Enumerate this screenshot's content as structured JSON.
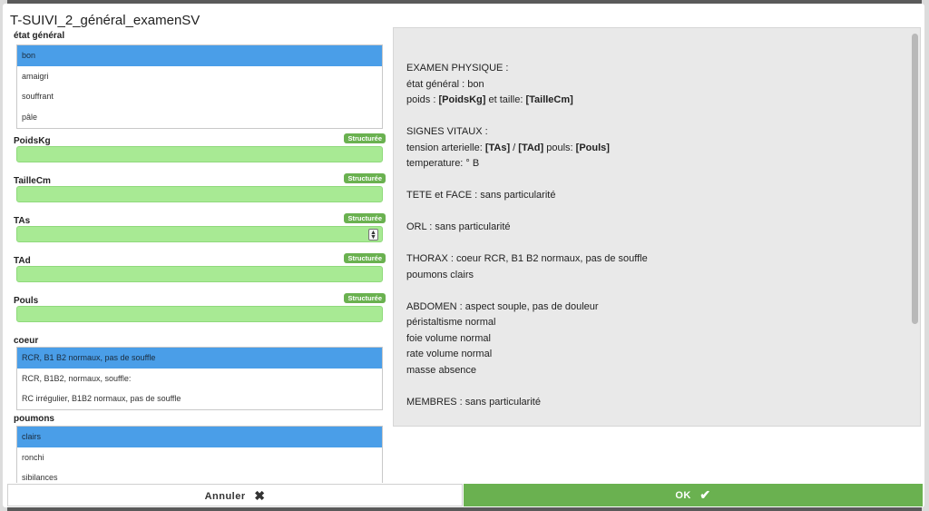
{
  "dialog": {
    "title": "T-SUIVI_2_général_examenSV"
  },
  "form": {
    "etat_general": {
      "label": "état général",
      "options": [
        "bon",
        "amaigri",
        "souffrant",
        "pâle"
      ],
      "selected": "bon"
    },
    "structured_badge": "Structurée",
    "poids": {
      "label": "PoidsKg",
      "value": ""
    },
    "taille": {
      "label": "TailleCm",
      "value": ""
    },
    "tas": {
      "label": "TAs",
      "value": ""
    },
    "tad": {
      "label": "TAd",
      "value": ""
    },
    "pouls": {
      "label": "Pouls",
      "value": ""
    },
    "coeur": {
      "label": "coeur",
      "options": [
        "RCR, B1 B2 normaux, pas de souffle",
        "RCR, B1B2, normaux, souffle:",
        "RC irrégulier, B1B2 normaux, pas de souffle"
      ],
      "selected": "RCR, B1 B2 normaux, pas de souffle"
    },
    "poumons": {
      "label": "poumons",
      "options": [
        "clairs",
        "ronchi",
        "sibilances"
      ],
      "selected": "clairs"
    }
  },
  "report": {
    "lines": [
      "EXAMEN PHYSIQUE :",
      "état général : bon",
      "poids : |[PoidsKg]| et taille: |[TailleCm]|",
      "",
      "SIGNES VITAUX :",
      "tension arterielle: |[TAs]| / |[TAd]| pouls: |[Pouls]|",
      "temperature: ° B",
      "",
      "TETE et FACE : sans particularité",
      "",
      "ORL : sans particularité",
      "",
      "THORAX : coeur RCR, B1 B2 normaux, pas de souffle",
      "poumons clairs",
      "",
      "ABDOMEN : aspect souple, pas de douleur",
      "péristaltisme normal",
      "foie volume normal",
      "rate volume normal",
      "masse absence",
      "",
      "MEMBRES : sans particularité"
    ]
  },
  "footer": {
    "cancel_label": "Annuler",
    "cancel_icon": "close-icon",
    "ok_label": "OK",
    "ok_icon": "check-icon"
  },
  "colors": {
    "selected_row": "#4a9ee8",
    "input_green": "#a8ea94",
    "badge_green": "#6ab150",
    "ok_button": "#6ab150"
  }
}
